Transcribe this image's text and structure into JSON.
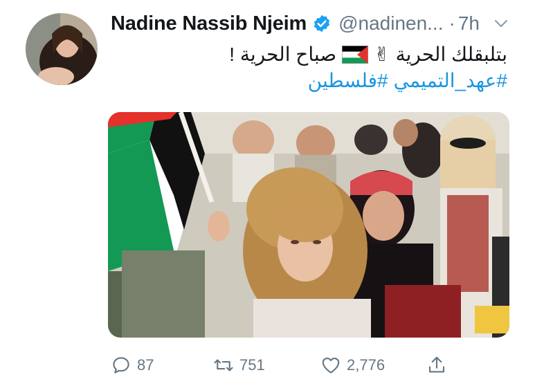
{
  "tweet": {
    "display_name": "Nadine Nassib Njeim",
    "handle": "@nadinen...",
    "separator": "·",
    "timestamp": "7h",
    "verified": true,
    "avatar_icon": "avatar-photo",
    "text_line1_part1": "بتلبقلك الحرية",
    "text_line1_part2": "صباح الحرية !",
    "emoji_victory": "✌",
    "emoji_flag": "palestine-flag",
    "hashtag1": "#عهد_التميمي",
    "hashtag2": "#فلسطين"
  },
  "actions": {
    "reply_count": "87",
    "retweet_count": "751",
    "like_count": "2,776"
  },
  "colors": {
    "link": "#1b95e0",
    "muted": "#657786",
    "verified_blue": "#1da1f2",
    "flag_green": "#149954",
    "flag_red": "#e4312b",
    "flag_black": "#000000"
  }
}
